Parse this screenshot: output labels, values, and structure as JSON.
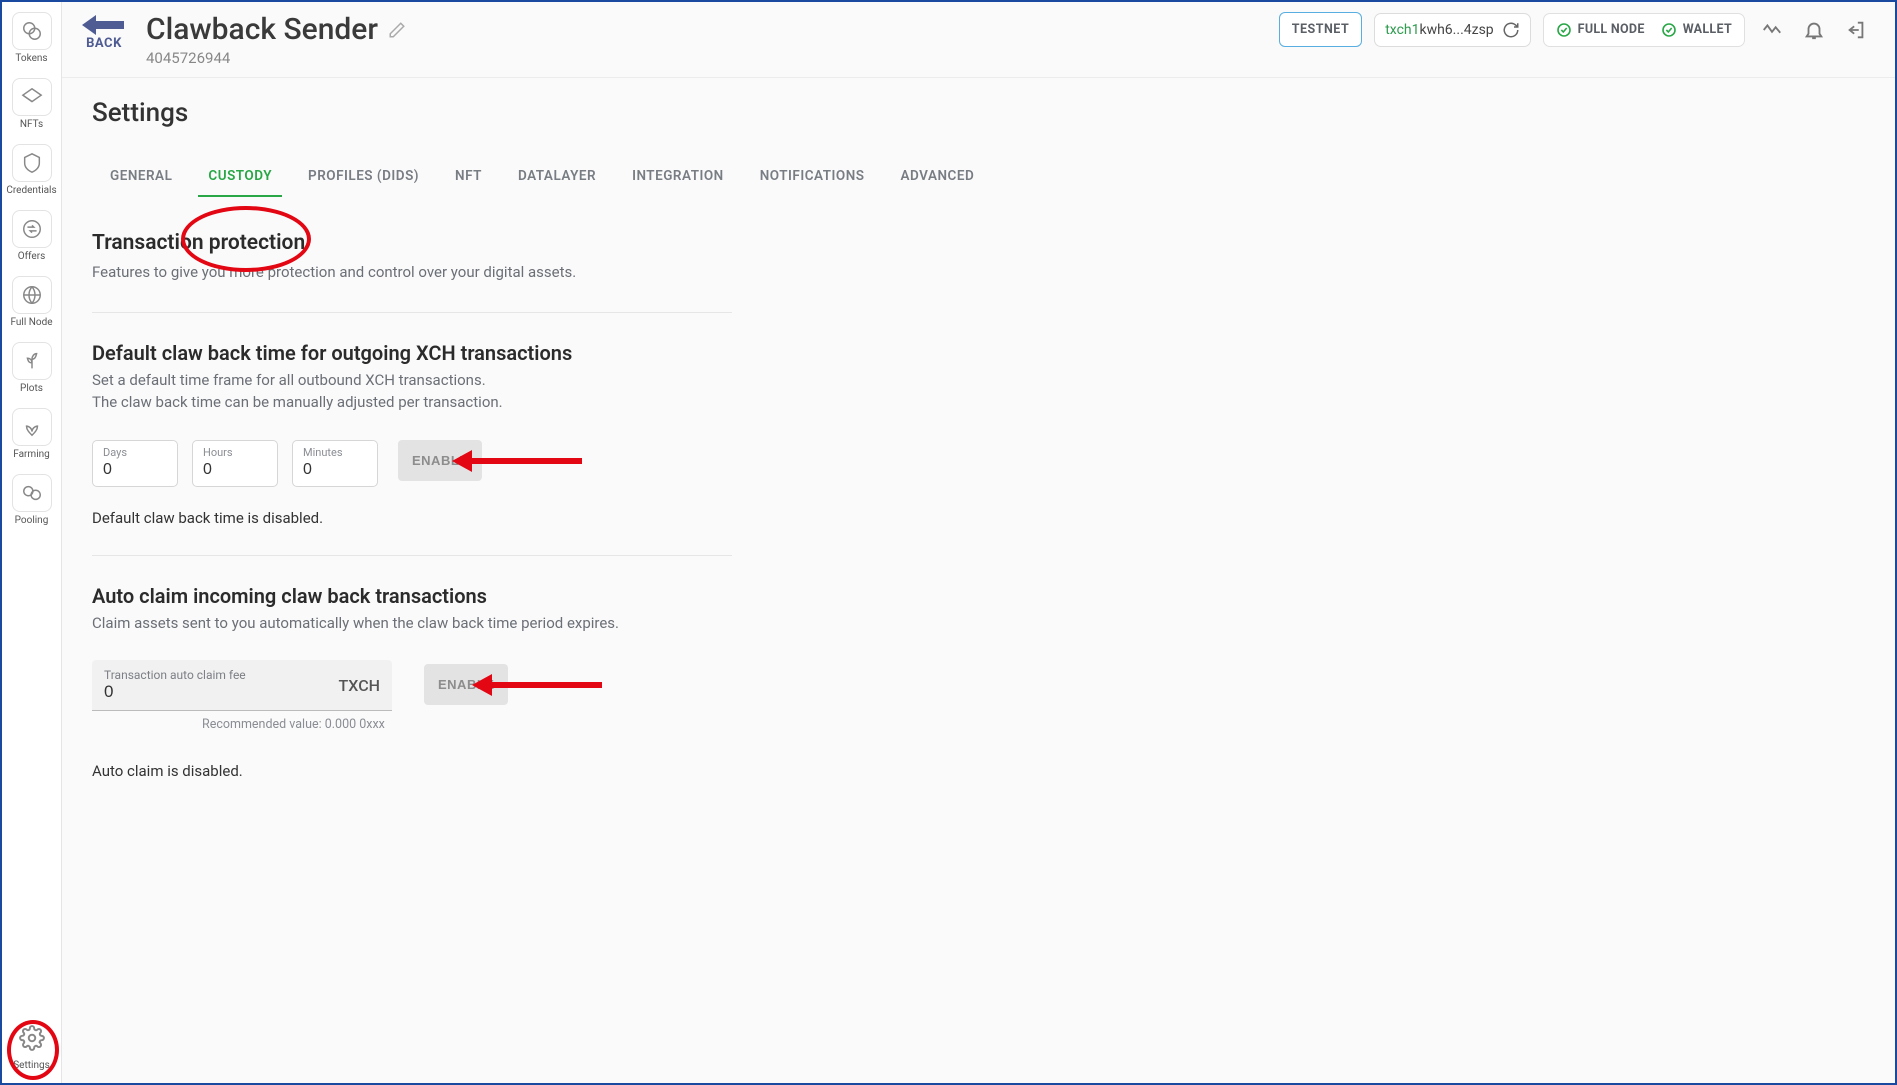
{
  "sidebar": {
    "items": [
      {
        "label": "Tokens",
        "icon": "tokens-icon"
      },
      {
        "label": "NFTs",
        "icon": "nfts-icon"
      },
      {
        "label": "Credentials",
        "icon": "credentials-icon"
      },
      {
        "label": "Offers",
        "icon": "offers-icon"
      },
      {
        "label": "Full Node",
        "icon": "fullnode-icon"
      },
      {
        "label": "Plots",
        "icon": "plots-icon"
      },
      {
        "label": "Farming",
        "icon": "farming-icon"
      },
      {
        "label": "Pooling",
        "icon": "pooling-icon"
      }
    ],
    "bottom": {
      "label": "Settings",
      "icon": "settings-icon"
    }
  },
  "header": {
    "back": "BACK",
    "title": "Clawback Sender",
    "subtitle": "4045726944",
    "testnet": "TESTNET",
    "addr_prefix": "txch1",
    "addr_rest": "kwh6...4zsp",
    "status_fullnode": "FULL NODE",
    "status_wallet": "WALLET"
  },
  "settings": {
    "heading": "Settings",
    "tabs": [
      "GENERAL",
      "CUSTODY",
      "PROFILES (DIDS)",
      "NFT",
      "DATALAYER",
      "INTEGRATION",
      "NOTIFICATIONS",
      "ADVANCED"
    ],
    "active_tab_index": 1,
    "protection": {
      "title": "Transaction protection",
      "desc": "Features to give you more protection and control over your digital assets."
    },
    "clawback": {
      "title": "Default claw back time for outgoing XCH transactions",
      "desc1": "Set a default time frame for all outbound XCH transactions.",
      "desc2": "The claw back time can be manually adjusted per transaction.",
      "days_label": "Days",
      "hours_label": "Hours",
      "minutes_label": "Minutes",
      "days_value": "0",
      "hours_value": "0",
      "minutes_value": "0",
      "enable": "ENABLE",
      "status": "Default claw back time is disabled."
    },
    "autoclaim": {
      "title": "Auto claim incoming claw back transactions",
      "desc": "Claim assets sent to you automatically when the claw back time period expires.",
      "fee_label": "Transaction auto claim fee",
      "fee_value": "0",
      "fee_unit": "TXCH",
      "enable": "ENABLE",
      "recommended": "Recommended value: 0.000 0xxx",
      "status": "Auto claim is disabled."
    }
  }
}
